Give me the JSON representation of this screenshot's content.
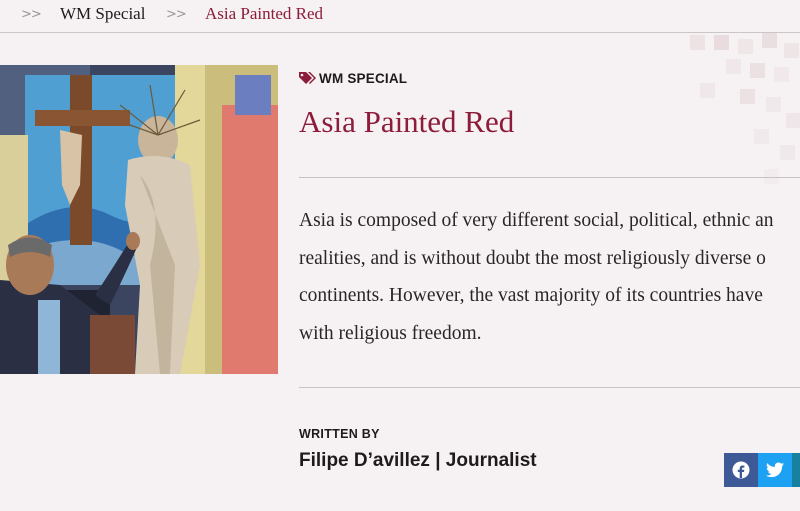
{
  "breadcrumb": {
    "separator": ">>",
    "items": [
      "WM Special",
      "Asia Painted Red"
    ]
  },
  "article": {
    "tag": "WM SPECIAL",
    "title": "Asia Painted Red",
    "body_lines": [
      "Asia is composed of very different social, political, ethnic an",
      "realities, and is without doubt the most religiously diverse o",
      "continents. However, the vast majority of its countries have",
      "with religious freedom."
    ],
    "written_by_label": "WRITTEN BY",
    "author": "Filipe D’avillez | Journalist"
  },
  "share": {
    "buttons": [
      "facebook-icon",
      "twitter-icon"
    ]
  },
  "colors": {
    "accent": "#8c1c3a",
    "background": "#f6f1f2",
    "facebook": "#3d5a96",
    "twitter": "#1da1f2"
  }
}
